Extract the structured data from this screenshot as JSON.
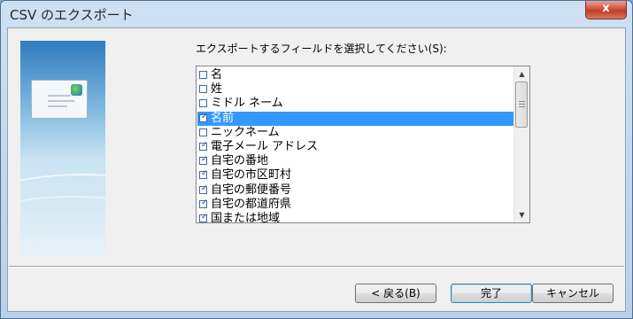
{
  "window": {
    "title": "CSV のエクスポート",
    "close_glyph": "x"
  },
  "list": {
    "label": "エクスポートするフィールドを選択してください(S):",
    "items": [
      {
        "label": "名",
        "checked": false,
        "selected": false
      },
      {
        "label": "姓",
        "checked": false,
        "selected": false
      },
      {
        "label": "ミドル ネーム",
        "checked": false,
        "selected": false
      },
      {
        "label": "名前",
        "checked": true,
        "selected": true
      },
      {
        "label": "ニックネーム",
        "checked": false,
        "selected": false
      },
      {
        "label": "電子メール アドレス",
        "checked": true,
        "selected": false
      },
      {
        "label": "自宅の番地",
        "checked": true,
        "selected": false
      },
      {
        "label": "自宅の市区町村",
        "checked": true,
        "selected": false
      },
      {
        "label": "自宅の郵便番号",
        "checked": true,
        "selected": false
      },
      {
        "label": "自宅の都道府県",
        "checked": true,
        "selected": false
      },
      {
        "label": "国または地域",
        "checked": true,
        "selected": false
      }
    ],
    "scroll_up_glyph": "▲",
    "scroll_down_glyph": "▼"
  },
  "buttons": {
    "back": "< 戻る(B)",
    "finish": "完了",
    "cancel": "キャンセル"
  },
  "colors": {
    "selection": "#3399ff",
    "close_button": "#c03b26"
  },
  "icons": {
    "side_image": "export-envelope-illustration",
    "checkbox": "checkbox-icon"
  }
}
